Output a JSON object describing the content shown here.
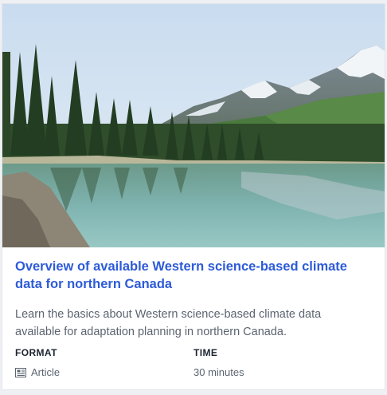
{
  "card": {
    "image": {
      "subject": "lake-with-forest-and-snow-mountains"
    },
    "title": "Overview of available Western science-based climate data for northern Canada",
    "description": "Learn the basics about Western science-based climate data available for adaptation planning in northern Canada.",
    "format": {
      "label": "FORMAT",
      "value": "Article",
      "icon": "article-icon"
    },
    "time": {
      "label": "TIME",
      "value": "30 minutes"
    }
  },
  "colors": {
    "title_link": "#2d5bd8",
    "text": "#5b6470",
    "label": "#1d2430"
  }
}
